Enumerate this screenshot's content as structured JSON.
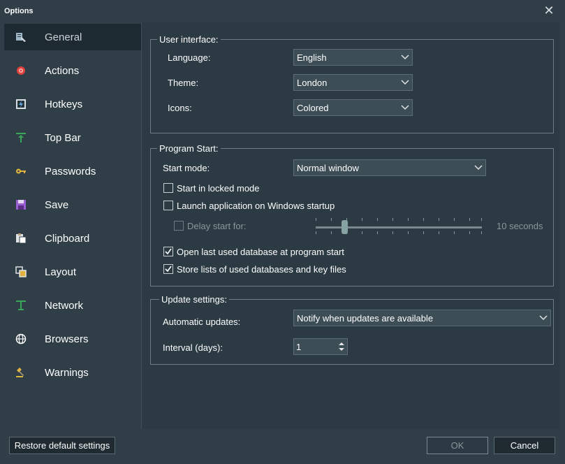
{
  "window": {
    "title": "Options",
    "close_glyph": "✕"
  },
  "sidebar": {
    "items": [
      {
        "label": "General",
        "icon": "general-icon",
        "active": true
      },
      {
        "label": "Actions",
        "icon": "gear-icon"
      },
      {
        "label": "Hotkeys",
        "icon": "hotkey-icon"
      },
      {
        "label": "Top Bar",
        "icon": "topbar-icon"
      },
      {
        "label": "Passwords",
        "icon": "key-icon"
      },
      {
        "label": "Save",
        "icon": "save-icon"
      },
      {
        "label": "Clipboard",
        "icon": "clipboard-icon"
      },
      {
        "label": "Layout",
        "icon": "layout-icon"
      },
      {
        "label": "Network",
        "icon": "network-icon"
      },
      {
        "label": "Browsers",
        "icon": "globe-icon"
      },
      {
        "label": "Warnings",
        "icon": "gavel-icon"
      }
    ]
  },
  "user_interface": {
    "legend": "User interface:",
    "language_label": "Language:",
    "language_value": "English",
    "theme_label": "Theme:",
    "theme_value": "London",
    "icons_label": "Icons:",
    "icons_value": "Colored"
  },
  "program_start": {
    "legend": "Program Start:",
    "start_mode_label": "Start mode:",
    "start_mode_value": "Normal window",
    "locked_label": "Start in locked mode",
    "locked_checked": false,
    "launch_label": "Launch application on Windows startup",
    "launch_checked": false,
    "delay_label": "Delay start for:",
    "delay_checked": false,
    "delay_value": "10 seconds",
    "open_last_label": "Open last used database at program start",
    "open_last_checked": true,
    "store_lists_label": "Store lists of used databases and key files",
    "store_lists_checked": true
  },
  "update_settings": {
    "legend": "Update settings:",
    "auto_label": "Automatic updates:",
    "auto_value": "Notify when updates are available",
    "interval_label": "Interval (days):",
    "interval_value": "1"
  },
  "footer": {
    "restore_label": "Restore default settings",
    "ok_label": "OK",
    "cancel_label": "Cancel"
  },
  "colors": {
    "window_bg": "#2f3e47",
    "panel_bg": "#2b3a43",
    "active_item_bg": "#1e2a31",
    "slider_thumb": "#86a3a1"
  }
}
